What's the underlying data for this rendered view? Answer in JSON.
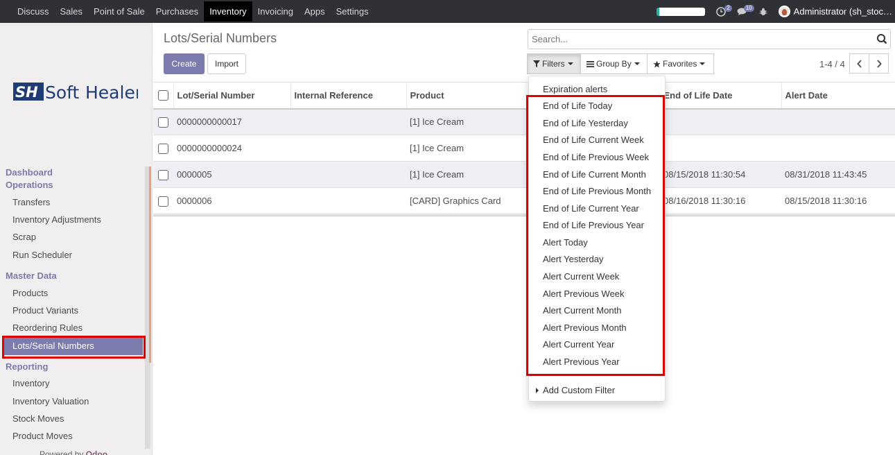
{
  "topbar": {
    "menu": [
      "Discuss",
      "Sales",
      "Point of Sale",
      "Purchases",
      "Inventory",
      "Invoicing",
      "Apps",
      "Settings"
    ],
    "active_menu": "Inventory",
    "activity_count": "2",
    "message_count": "10",
    "user_label": "Administrator (sh_stoc…"
  },
  "sidebar": {
    "logo_mark": "SH",
    "logo_text": "Soft Healer",
    "sections": [
      {
        "title": "Dashboard",
        "items": []
      },
      {
        "title": "Operations",
        "items": [
          "Transfers",
          "Inventory Adjustments",
          "Scrap",
          "Run Scheduler"
        ]
      },
      {
        "title": "Master Data",
        "items": [
          "Products",
          "Product Variants",
          "Reordering Rules",
          "Lots/Serial Numbers"
        ]
      },
      {
        "title": "Reporting",
        "items": [
          "Inventory",
          "Inventory Valuation",
          "Stock Moves",
          "Product Moves"
        ]
      }
    ],
    "active_item": "Lots/Serial Numbers",
    "powered_prefix": "Powered by",
    "powered_brand": "Odoo"
  },
  "control": {
    "title": "Lots/Serial Numbers",
    "create_label": "Create",
    "import_label": "Import",
    "search_placeholder": "Search...",
    "filters_label": "Filters",
    "groupby_label": "Group By",
    "favorites_label": "Favorites",
    "pager_text": "1-4 / 4"
  },
  "table": {
    "columns": [
      "Lot/Serial Number",
      "Internal Reference",
      "Product",
      "",
      "End of Life Date",
      "Alert Date"
    ],
    "rows": [
      {
        "lot": "0000000000017",
        "ref": "",
        "product": "[1] Ice Cream",
        "eol": "",
        "alert": ""
      },
      {
        "lot": "0000000000024",
        "ref": "",
        "product": "[1] Ice Cream",
        "eol": "",
        "alert": ""
      },
      {
        "lot": "0000005",
        "ref": "",
        "product": "[1] Ice Cream",
        "eol": "08/15/2018 11:30:54",
        "alert": "08/31/2018 11:43:45"
      },
      {
        "lot": "0000006",
        "ref": "",
        "product": "[CARD] Graphics Card",
        "eol": "08/16/2018 11:30:16",
        "alert": "08/15/2018 11:30:16"
      }
    ]
  },
  "filters_dropdown": {
    "items": [
      "Expiration alerts",
      "End of Life Today",
      "End of Life Yesterday",
      "End of Life Current Week",
      "End of Life Previous Week",
      "End of Life Current Month",
      "End of Life Previous Month",
      "End of Life Current Year",
      "End of Life Previous Year",
      "Alert Today",
      "Alert Yesterday",
      "Alert Current Week",
      "Alert Previous Week",
      "Alert Current Month",
      "Alert Previous Month",
      "Alert Current Year",
      "Alert Previous Year"
    ],
    "custom_label": "Add Custom Filter"
  },
  "colors": {
    "accent": "#7c7bad",
    "topbar": "#2f3136",
    "highlight_box": "#e00000"
  }
}
